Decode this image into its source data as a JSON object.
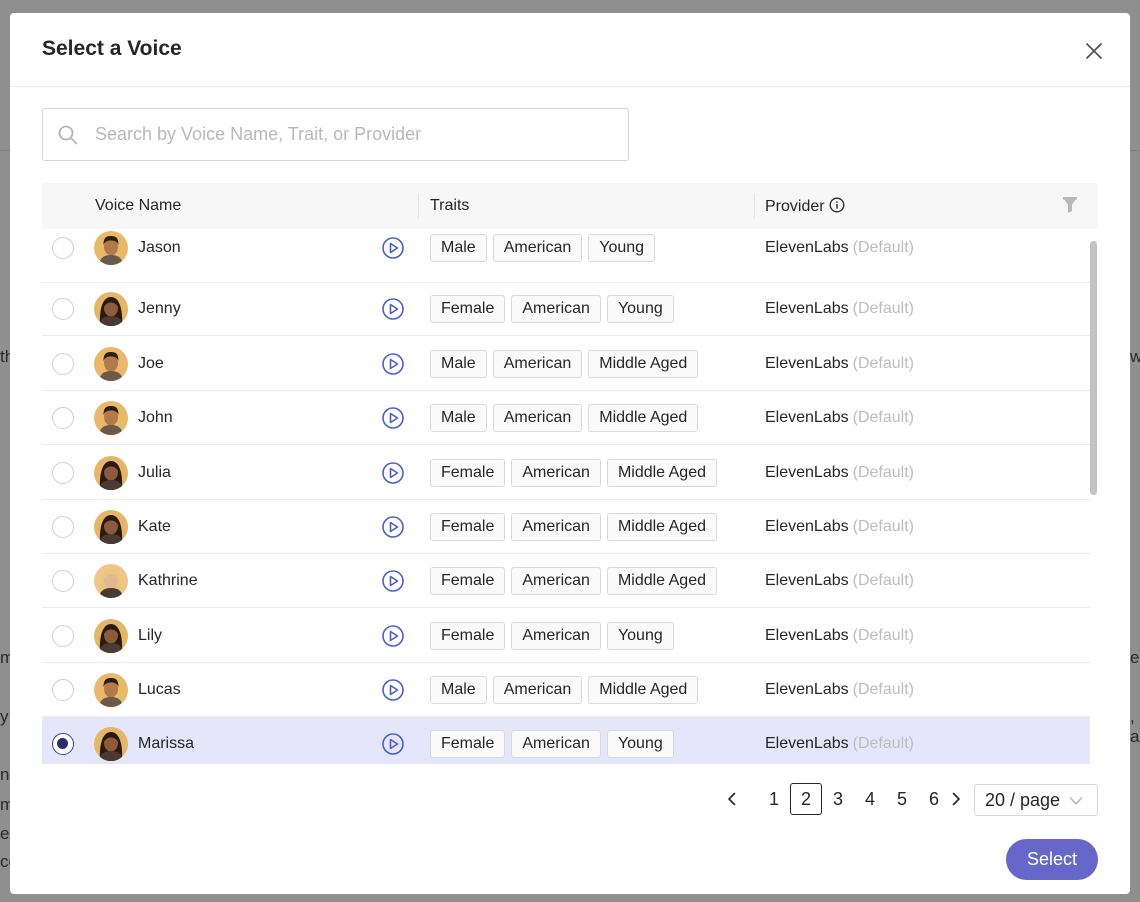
{
  "background": {
    "fragments": [
      "th",
      "w",
      "m",
      "es",
      "y",
      ", a",
      "n",
      "m",
      "er",
      "co"
    ]
  },
  "dialog": {
    "title": "Select a Voice",
    "close_icon": "close-icon"
  },
  "search": {
    "placeholder": "Search by Voice Name, Trait, or Provider",
    "value": ""
  },
  "table": {
    "columns": {
      "voice_name": "Voice Name",
      "traits": "Traits",
      "provider": "Provider"
    },
    "rows": [
      {
        "name": "Jason",
        "traits": [
          "Male",
          "American",
          "Young"
        ],
        "provider": "ElevenLabs",
        "note": "(Default)",
        "selected": false,
        "gender": "male"
      },
      {
        "name": "Jenny",
        "traits": [
          "Female",
          "American",
          "Young"
        ],
        "provider": "ElevenLabs",
        "note": "(Default)",
        "selected": false,
        "gender": "female"
      },
      {
        "name": "Joe",
        "traits": [
          "Male",
          "American",
          "Middle Aged"
        ],
        "provider": "ElevenLabs",
        "note": "(Default)",
        "selected": false,
        "gender": "male"
      },
      {
        "name": "John",
        "traits": [
          "Male",
          "American",
          "Middle Aged"
        ],
        "provider": "ElevenLabs",
        "note": "(Default)",
        "selected": false,
        "gender": "male"
      },
      {
        "name": "Julia",
        "traits": [
          "Female",
          "American",
          "Middle Aged"
        ],
        "provider": "ElevenLabs",
        "note": "(Default)",
        "selected": false,
        "gender": "female"
      },
      {
        "name": "Kate",
        "traits": [
          "Female",
          "American",
          "Middle Aged"
        ],
        "provider": "ElevenLabs",
        "note": "(Default)",
        "selected": false,
        "gender": "female"
      },
      {
        "name": "Kathrine",
        "traits": [
          "Female",
          "American",
          "Middle Aged"
        ],
        "provider": "ElevenLabs",
        "note": "(Default)",
        "selected": false,
        "gender": "female-blonde"
      },
      {
        "name": "Lily",
        "traits": [
          "Female",
          "American",
          "Young"
        ],
        "provider": "ElevenLabs",
        "note": "(Default)",
        "selected": false,
        "gender": "female"
      },
      {
        "name": "Lucas",
        "traits": [
          "Male",
          "American",
          "Middle Aged"
        ],
        "provider": "ElevenLabs",
        "note": "(Default)",
        "selected": false,
        "gender": "male"
      },
      {
        "name": "Marissa",
        "traits": [
          "Female",
          "American",
          "Young"
        ],
        "provider": "ElevenLabs",
        "note": "(Default)",
        "selected": true,
        "gender": "female"
      }
    ]
  },
  "pagination": {
    "pages": [
      "1",
      "2",
      "3",
      "4",
      "5",
      "6"
    ],
    "current": "2",
    "page_size": "20 / page"
  },
  "footer": {
    "select_label": "Select"
  },
  "colors": {
    "accent": "#6667c9",
    "selected_row": "#e6e6fb",
    "play_icon": "#4b5fc7"
  }
}
